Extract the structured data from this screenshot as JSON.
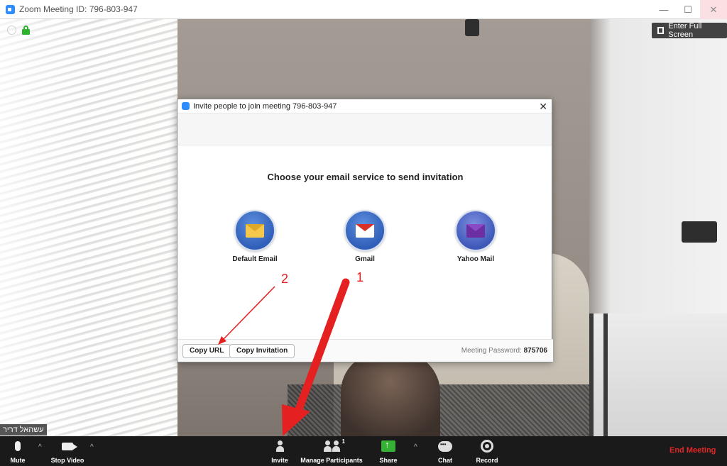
{
  "window": {
    "title": "Zoom Meeting ID: 796-803-947",
    "controls": {
      "minimize": "—",
      "maximize": "☐",
      "close": "✕"
    }
  },
  "video": {
    "fullscreen_label": "Enter Full Screen",
    "participant_name": "עשהאל דריר"
  },
  "dialog": {
    "title": "Invite people to join meeting 796-803-947",
    "close": "✕",
    "heading": "Choose your email service to send invitation",
    "services": [
      {
        "label": "Default Email",
        "icon": "default-email-icon"
      },
      {
        "label": "Gmail",
        "icon": "gmail-icon"
      },
      {
        "label": "Yahoo Mail",
        "icon": "yahoo-mail-icon"
      }
    ],
    "copy_url": "Copy URL",
    "copy_invitation": "Copy Invitation",
    "password_label": "Meeting Password:",
    "password_value": "875706"
  },
  "annotations": {
    "marker_1": "1",
    "marker_2": "2",
    "color": "#e52020"
  },
  "toolbar": {
    "mute": "Mute",
    "stop_video": "Stop Video",
    "invite": "Invite",
    "manage_participants": "Manage Participants",
    "participant_count": "1",
    "share": "Share",
    "chat": "Chat",
    "record": "Record",
    "end_meeting": "End Meeting",
    "caret": "^"
  },
  "colors": {
    "zoom_blue": "#2d8cff",
    "end_red": "#e52525",
    "share_green": "#35b135"
  }
}
